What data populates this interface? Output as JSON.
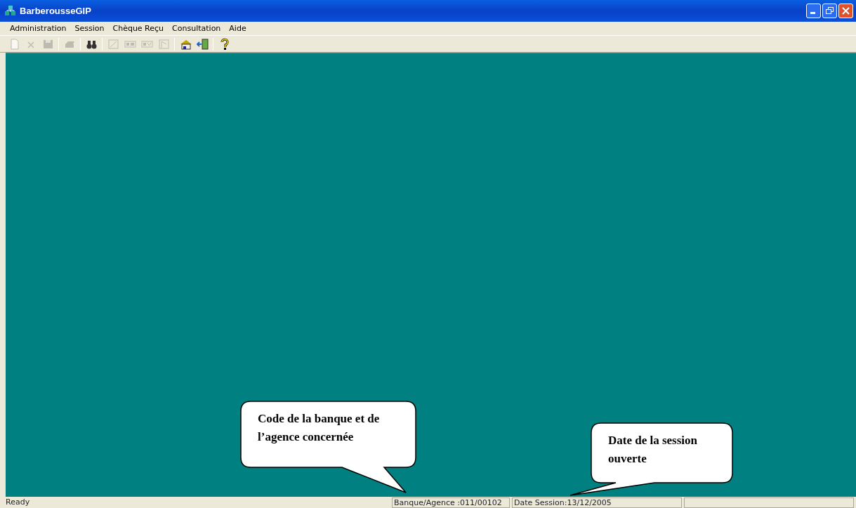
{
  "window": {
    "title": "BarberousseGIP"
  },
  "menu": [
    "Administration",
    "Session",
    "Chèque Reçu",
    "Consultation",
    "Aide"
  ],
  "toolbar": [
    {
      "kind": "new",
      "disabled": true
    },
    {
      "kind": "delete",
      "disabled": true
    },
    {
      "kind": "save",
      "disabled": true
    },
    {
      "kind": "sep"
    },
    {
      "kind": "print",
      "disabled": true
    },
    {
      "kind": "sep"
    },
    {
      "kind": "find",
      "disabled": false
    },
    {
      "kind": "sep"
    },
    {
      "kind": "doc",
      "disabled": true
    },
    {
      "kind": "pr",
      "disabled": true
    },
    {
      "kind": "pv",
      "disabled": true
    },
    {
      "kind": "chart",
      "disabled": true
    },
    {
      "kind": "sep"
    },
    {
      "kind": "home",
      "disabled": false
    },
    {
      "kind": "exit",
      "disabled": false
    },
    {
      "kind": "sep"
    },
    {
      "kind": "help",
      "disabled": false
    }
  ],
  "callouts": [
    {
      "text": "Code de la banque et de l’agence concernée"
    },
    {
      "text": "Date de la session ouverte"
    }
  ],
  "status_bar": {
    "message": "Ready",
    "panels": [
      "Banque/Agence :011/00102",
      "Date Session:13/12/2005"
    ]
  }
}
